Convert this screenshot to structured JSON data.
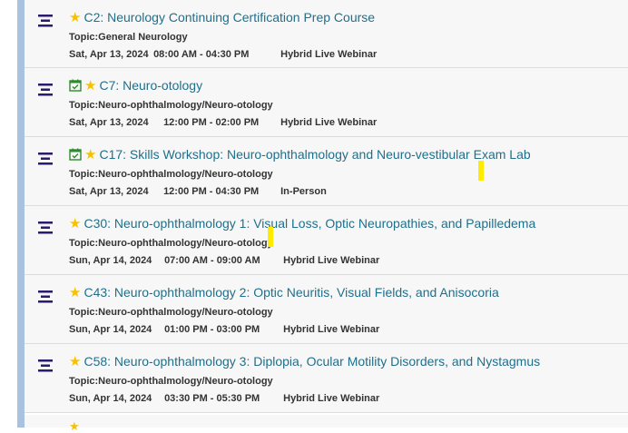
{
  "sessions": [
    {
      "title": "C2: Neurology Continuing Certification Prep Course",
      "topic": "Topic:General Neurology",
      "date": "Sat, Apr 13, 2024",
      "time": "08:00 AM - 04:30 PM",
      "format": "Hybrid Live Webinar",
      "calendar": false
    },
    {
      "title": "C7: Neuro-otology",
      "topic": "Topic:Neuro-ophthalmology/Neuro-otology",
      "date": "Sat, Apr 13, 2024",
      "time": "12:00 PM - 02:00 PM",
      "format": "Hybrid Live Webinar",
      "calendar": true
    },
    {
      "title": "C17: Skills Workshop: Neuro-ophthalmology and Neuro-vestibular Exam Lab",
      "topic": "Topic:Neuro-ophthalmology/Neuro-otology",
      "date": "Sat, Apr 13, 2024",
      "time": "12:00 PM - 04:30 PM",
      "format": "In-Person",
      "calendar": true
    },
    {
      "title": "C30: Neuro-ophthalmology 1: Visual Loss, Optic Neuropathies, and Papilledema",
      "topic": "Topic:Neuro-ophthalmology/Neuro-otology",
      "date": "Sun, Apr 14, 2024",
      "time": "07:00 AM - 09:00 AM",
      "format": "Hybrid Live Webinar",
      "calendar": false
    },
    {
      "title": "C43: Neuro-ophthalmology 2: Optic Neuritis, Visual Fields, and Anisocoria",
      "topic": "Topic:Neuro-ophthalmology/Neuro-otology",
      "date": "Sun, Apr 14, 2024",
      "time": "01:00 PM - 03:00 PM",
      "format": "Hybrid Live Webinar",
      "calendar": false
    },
    {
      "title": "C58: Neuro-ophthalmology 3: Diplopia, Ocular Motility Disorders, and Nystagmus",
      "topic": "Topic:Neuro-ophthalmology/Neuro-otology",
      "date": "Sun, Apr 14, 2024",
      "time": "03:30 PM - 05:30 PM",
      "format": "Hybrid Live Webinar",
      "calendar": false
    }
  ],
  "colors": {
    "link": "#1f6f8b",
    "star": "#f6c200",
    "calendar": "#2e8b2e",
    "menu": "#2b1a6e",
    "stripe": "#a9c2e0"
  }
}
